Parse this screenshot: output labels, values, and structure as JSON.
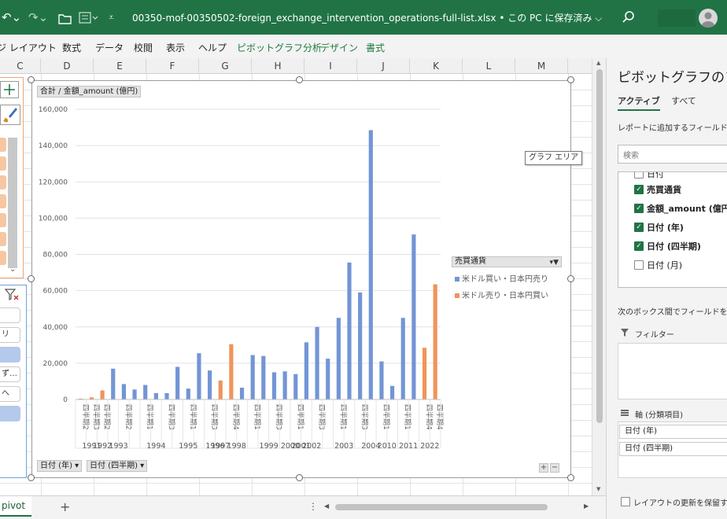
{
  "titlebar": {
    "title": "00350-mof-00350502-foreign_exchange_intervention_operations-full-list.xlsx • この PC に保存済み ⌵",
    "bg_color": "#217346"
  },
  "ribbon": {
    "tabs": [
      "ジ レイアウト",
      "数式",
      "データ",
      "校閲",
      "表示",
      "ヘルプ"
    ],
    "context_tabs": [
      "ピボットグラフ分析",
      "デザイン",
      "書式"
    ]
  },
  "columns": [
    "C",
    "D",
    "E",
    "F",
    "G",
    "H",
    "I",
    "J",
    "K",
    "L",
    "M"
  ],
  "slicer_items": [
    "",
    "リ",
    "",
    "ず…",
    "へ",
    ""
  ],
  "chart": {
    "value_field_button": "合計 / 金額_amount (億円)",
    "axis_field_buttons": [
      "日付 (年) ▾",
      "日付 (四半期) ▾"
    ],
    "tooltip": "グラフ エリア",
    "legend_title": "売買通貨",
    "zoom_plus": "+",
    "zoom_minus": "−"
  },
  "chart_data": {
    "type": "bar",
    "ylim": [
      0,
      160000
    ],
    "yticks": [
      "0",
      "20,000",
      "40,000",
      "60,000",
      "80,000",
      "100,000",
      "120,000",
      "140,000",
      "160,000"
    ],
    "series": [
      {
        "name": "米ドル買い・日本円売り",
        "color": "#7395d5"
      },
      {
        "name": "米ドル売り・日本円買い",
        "color": "#f0945a"
      }
    ],
    "bars": [
      {
        "q": "四半期2",
        "blue": 0,
        "orange": 500
      },
      {
        "q": "四半期3",
        "blue": 0,
        "orange": 1200
      },
      {
        "q": "四半期2",
        "blue": 0,
        "orange": 5000
      },
      {
        "q": "",
        "blue": 17000,
        "orange": 0
      },
      {
        "q": "四半期2",
        "blue": 8500,
        "orange": 0
      },
      {
        "q": "",
        "blue": 5500,
        "orange": 0
      },
      {
        "q": "四半期1",
        "blue": 8000,
        "orange": 0
      },
      {
        "q": "",
        "blue": 3500,
        "orange": 0
      },
      {
        "q": "四半期3",
        "blue": 3500,
        "orange": 0
      },
      {
        "q": "",
        "blue": 18000,
        "orange": 0
      },
      {
        "q": "四半期1",
        "blue": 6000,
        "orange": 0
      },
      {
        "q": "",
        "blue": 25500,
        "orange": 0
      },
      {
        "q": "四半期3",
        "blue": 16000,
        "orange": 0
      },
      {
        "q": "",
        "blue": 0,
        "orange": 10500
      },
      {
        "q": "四半期4",
        "blue": 0,
        "orange": 30500
      },
      {
        "q": "",
        "blue": 6500,
        "orange": 0
      },
      {
        "q": "四半期1",
        "blue": 24500,
        "orange": 0
      },
      {
        "q": "",
        "blue": 24000,
        "orange": 0
      },
      {
        "q": "四半期3",
        "blue": 15000,
        "orange": 0
      },
      {
        "q": "",
        "blue": 15500,
        "orange": 0
      },
      {
        "q": "四半期1",
        "blue": 14000,
        "orange": 0
      },
      {
        "q": "",
        "blue": 31500,
        "orange": 0
      },
      {
        "q": "四半期3",
        "blue": 40000,
        "orange": 0
      },
      {
        "q": "",
        "blue": 22500,
        "orange": 0
      },
      {
        "q": "四半期1",
        "blue": 45000,
        "orange": 0
      },
      {
        "q": "",
        "blue": 75500,
        "orange": 0
      },
      {
        "q": "四半期3",
        "blue": 59000,
        "orange": 0
      },
      {
        "q": "",
        "blue": 148500,
        "orange": 0
      },
      {
        "q": "四半期1",
        "blue": 21000,
        "orange": 0
      },
      {
        "q": "",
        "blue": 7500,
        "orange": 0
      },
      {
        "q": "四半期1",
        "blue": 45000,
        "orange": 0
      },
      {
        "q": "",
        "blue": 91000,
        "orange": 0
      },
      {
        "q": "四半期4",
        "blue": 0,
        "orange": 28500
      },
      {
        "q": "四半期4",
        "blue": 0,
        "orange": 63500
      }
    ],
    "years": [
      {
        "label": "1991",
        "at": 1
      },
      {
        "label": "1992",
        "at": 2
      },
      {
        "label": "1993",
        "at": 3.5
      },
      {
        "label": "1994",
        "at": 7
      },
      {
        "label": "1995",
        "at": 10
      },
      {
        "label": "1996",
        "at": 12.5
      },
      {
        "label": "1997",
        "at": 13
      },
      {
        "label": "1998",
        "at": 14.5
      },
      {
        "label": "1999",
        "at": 17.5
      },
      {
        "label": "2000",
        "at": 19.5
      },
      {
        "label": "2001",
        "at": 20.5
      },
      {
        "label": "2002",
        "at": 21.5
      },
      {
        "label": "2003",
        "at": 24.5
      },
      {
        "label": "2004",
        "at": 27
      },
      {
        "label": "2010",
        "at": 28.5
      },
      {
        "label": "2011",
        "at": 30.5
      },
      {
        "label": "2022",
        "at": 32.5
      }
    ]
  },
  "sheet": {
    "tab_label": "pivot",
    "add_label": "+"
  },
  "pane": {
    "title": "ピボットグラフのフィールド",
    "tabs": [
      "アクティブ",
      "すべて"
    ],
    "desc": "レポートに追加するフィールドを選択してください:",
    "search_placeholder": "検索",
    "fields": [
      {
        "label": "日付",
        "checked": false
      },
      {
        "label": "売買通貨",
        "checked": true
      },
      {
        "label": "金額_amount (億円)",
        "checked": true
      },
      {
        "label": "日付 (年)",
        "checked": true
      },
      {
        "label": "日付 (四半期)",
        "checked": true
      },
      {
        "label": "日付 (月)",
        "checked": false
      }
    ],
    "instruction": "次のボックス間でフィールドをドラッグしてください:",
    "filters_label": "フィルター",
    "axis_label": "軸 (分類項目)",
    "axis_items": [
      "日付 (年)",
      "日付 (四半期)"
    ],
    "defer_label": "レイアウトの更新を保留する"
  }
}
